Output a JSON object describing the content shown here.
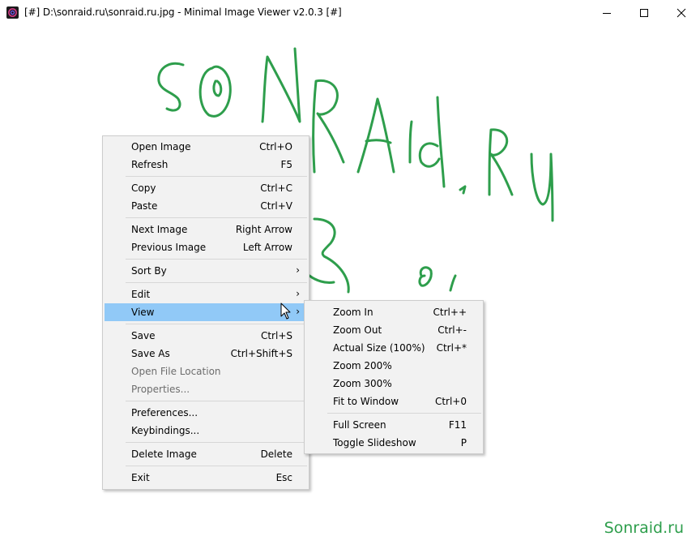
{
  "window": {
    "title": "[#] D:\\sonraid.ru\\sonraid.ru.jpg - Minimal Image Viewer v2.0.3 [#]"
  },
  "watermark": "Sonraid.ru",
  "colors": {
    "menu_bg": "#f2f2f2",
    "highlight": "#91c9f7",
    "ink": "#2e9e4c"
  },
  "context_menu": {
    "open_image": {
      "label": "Open Image",
      "accel": "Ctrl+O"
    },
    "refresh": {
      "label": "Refresh",
      "accel": "F5"
    },
    "copy": {
      "label": "Copy",
      "accel": "Ctrl+C"
    },
    "paste": {
      "label": "Paste",
      "accel": "Ctrl+V"
    },
    "next_image": {
      "label": "Next Image",
      "accel": "Right Arrow"
    },
    "previous_image": {
      "label": "Previous Image",
      "accel": "Left Arrow"
    },
    "sort_by": {
      "label": "Sort By",
      "arrow": "›"
    },
    "edit": {
      "label": "Edit",
      "arrow": "›"
    },
    "view": {
      "label": "View",
      "arrow": "›"
    },
    "save": {
      "label": "Save",
      "accel": "Ctrl+S"
    },
    "save_as": {
      "label": "Save As",
      "accel": "Ctrl+Shift+S"
    },
    "open_file_location": {
      "label": "Open File Location"
    },
    "properties": {
      "label": "Properties..."
    },
    "preferences": {
      "label": "Preferences..."
    },
    "keybindings": {
      "label": "Keybindings..."
    },
    "delete_image": {
      "label": "Delete Image",
      "accel": "Delete"
    },
    "exit": {
      "label": "Exit",
      "accel": "Esc"
    }
  },
  "view_submenu": {
    "zoom_in": {
      "label": "Zoom In",
      "accel": "Ctrl++"
    },
    "zoom_out": {
      "label": "Zoom Out",
      "accel": "Ctrl+-"
    },
    "actual_size": {
      "label": "Actual Size (100%)",
      "accel": "Ctrl+*"
    },
    "zoom_200": {
      "label": "Zoom 200%"
    },
    "zoom_300": {
      "label": "Zoom 300%"
    },
    "fit_to_window": {
      "label": "Fit to Window",
      "accel": "Ctrl+0"
    },
    "full_screen": {
      "label": "Full Screen",
      "accel": "F11"
    },
    "toggle_slideshow": {
      "label": "Toggle Slideshow",
      "accel": "P"
    }
  }
}
